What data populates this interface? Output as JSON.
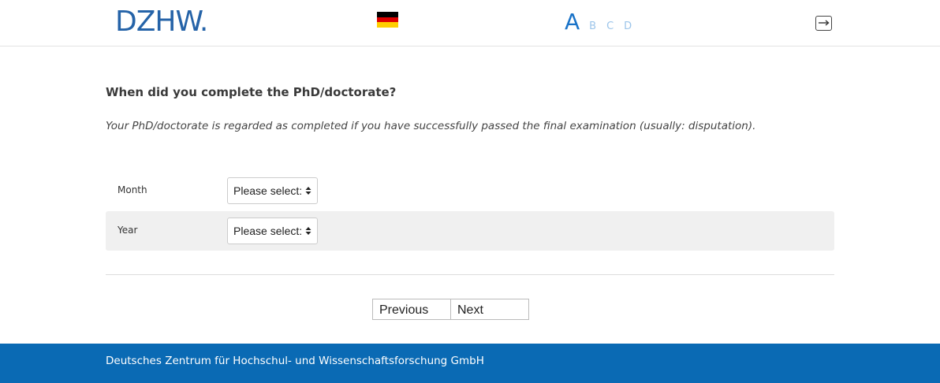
{
  "header": {
    "logo_text": "DZHW.",
    "language_flag": "german-flag",
    "font_sizes": [
      "A",
      "B",
      "C",
      "D"
    ],
    "logout_icon": "logout-icon"
  },
  "question": {
    "title": "When did you complete the PhD/doctorate?",
    "hint": "Your PhD/doctorate is regarded as completed if you have successfully passed the final examination (usually: disputation)."
  },
  "fields": {
    "month": {
      "label": "Month",
      "selected": "Please select:"
    },
    "year": {
      "label": "Year",
      "selected": "Please select:"
    }
  },
  "navigation": {
    "previous_label": "Previous",
    "next_label": "Next"
  },
  "footer": {
    "text": "Deutsches Zentrum für Hochschul- und Wissenschaftsforschung GmbH"
  },
  "colors": {
    "brand_blue": "#2563a8",
    "footer_blue": "#0a6ab4",
    "font_switch_active": "#1a73c8",
    "font_switch_inactive": "#9cc5ea"
  }
}
